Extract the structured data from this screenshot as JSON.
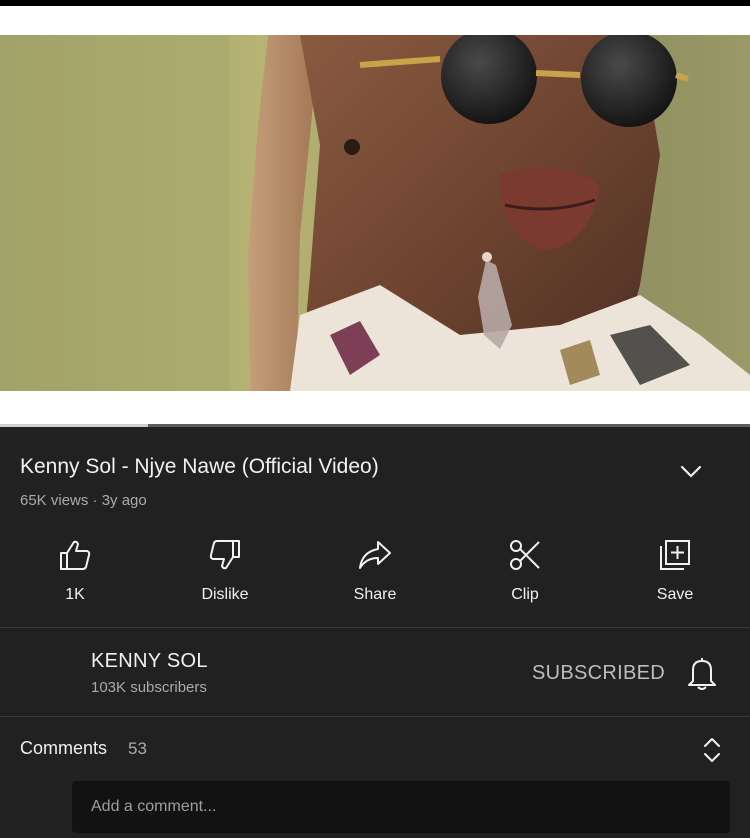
{
  "video": {
    "title": "Kenny Sol - Njye Nawe (Official Video)",
    "meta": "65K views · 3y ago",
    "progress_fraction": 0.197
  },
  "actions": {
    "like": {
      "label": "1K",
      "icon": "thumbs-up-icon"
    },
    "dislike": {
      "label": "Dislike",
      "icon": "thumbs-down-icon"
    },
    "share": {
      "label": "Share",
      "icon": "share-arrow-icon"
    },
    "clip": {
      "label": "Clip",
      "icon": "scissors-icon"
    },
    "save": {
      "label": "Save",
      "icon": "playlist-add-icon"
    }
  },
  "channel": {
    "name": "KENNY SOL",
    "subscribers": "103K subscribers",
    "subscribe_state": "SUBSCRIBED"
  },
  "comments": {
    "label": "Comments",
    "count": "53",
    "input_placeholder": "Add a comment..."
  },
  "colors": {
    "background": "#212121",
    "primary_text": "#f1f1f1",
    "secondary_text": "#aaaaaa",
    "comment_box": "#121212"
  }
}
